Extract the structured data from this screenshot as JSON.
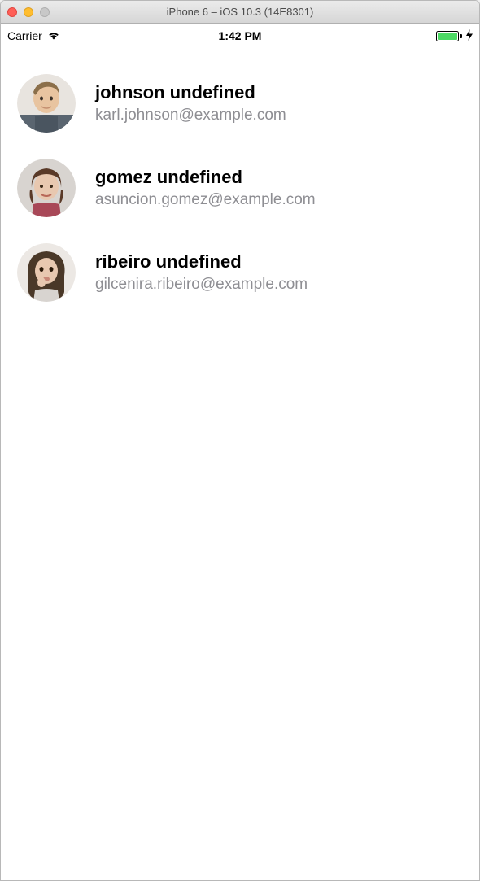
{
  "window": {
    "title": "iPhone 6 – iOS 10.3 (14E8301)"
  },
  "statusBar": {
    "carrier": "Carrier",
    "time": "1:42 PM"
  },
  "contacts": [
    {
      "name": "johnson undefined",
      "email": "karl.johnson@example.com"
    },
    {
      "name": "gomez undefined",
      "email": "asuncion.gomez@example.com"
    },
    {
      "name": "ribeiro undefined",
      "email": "gilcenira.ribeiro@example.com"
    }
  ]
}
